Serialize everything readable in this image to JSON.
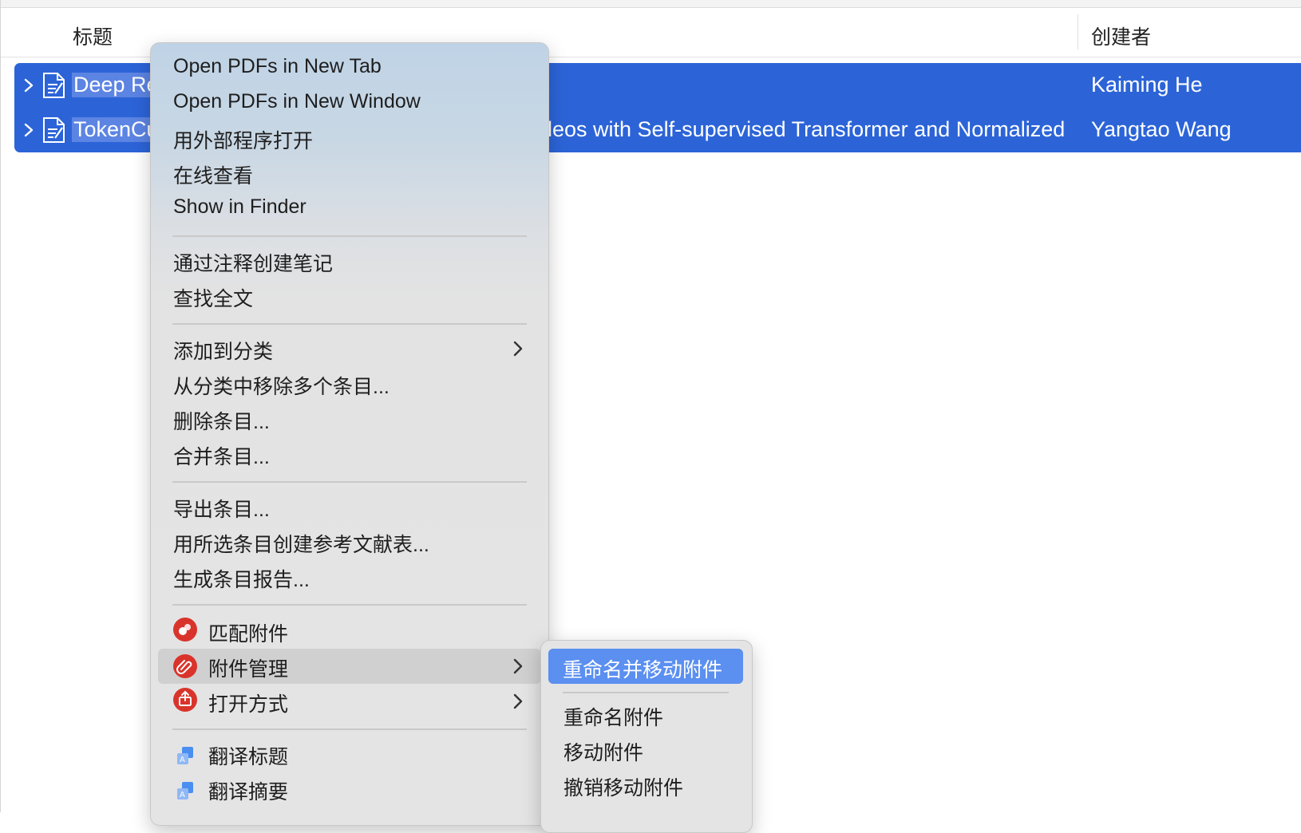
{
  "table": {
    "columns": {
      "title": "标题",
      "creator": "创建者"
    },
    "rows": [
      {
        "title_visible": "Deep Re",
        "title_tail": "",
        "creator": "Kaiming He"
      },
      {
        "title_visible": "TokenCu",
        "title_tail": "leos with Self-supervised Transformer and Normalized",
        "creator": "Yangtao Wang"
      }
    ]
  },
  "context_menu": {
    "group1": [
      "Open PDFs in New Tab",
      "Open PDFs in New Window",
      "用外部程序打开",
      "在线查看",
      "Show in Finder"
    ],
    "group2": [
      "通过注释创建笔记",
      "查找全文"
    ],
    "group3": [
      "添加到分类",
      "从分类中移除多个条目...",
      "删除条目...",
      "合并条目..."
    ],
    "group4": [
      "导出条目...",
      "用所选条目创建参考文献表...",
      "生成条目报告..."
    ],
    "group5": [
      "匹配附件",
      "附件管理",
      "打开方式"
    ],
    "group6": [
      "翻译标题",
      "翻译摘要"
    ]
  },
  "submenu": {
    "selected": "重命名并移动附件",
    "items": [
      "重命名附件",
      "移动附件",
      "撤销移动附件"
    ]
  },
  "colors": {
    "selection": "#2c64d8",
    "submenu_highlight": "#5b8ff0",
    "plugin_red": "#d9342b"
  }
}
